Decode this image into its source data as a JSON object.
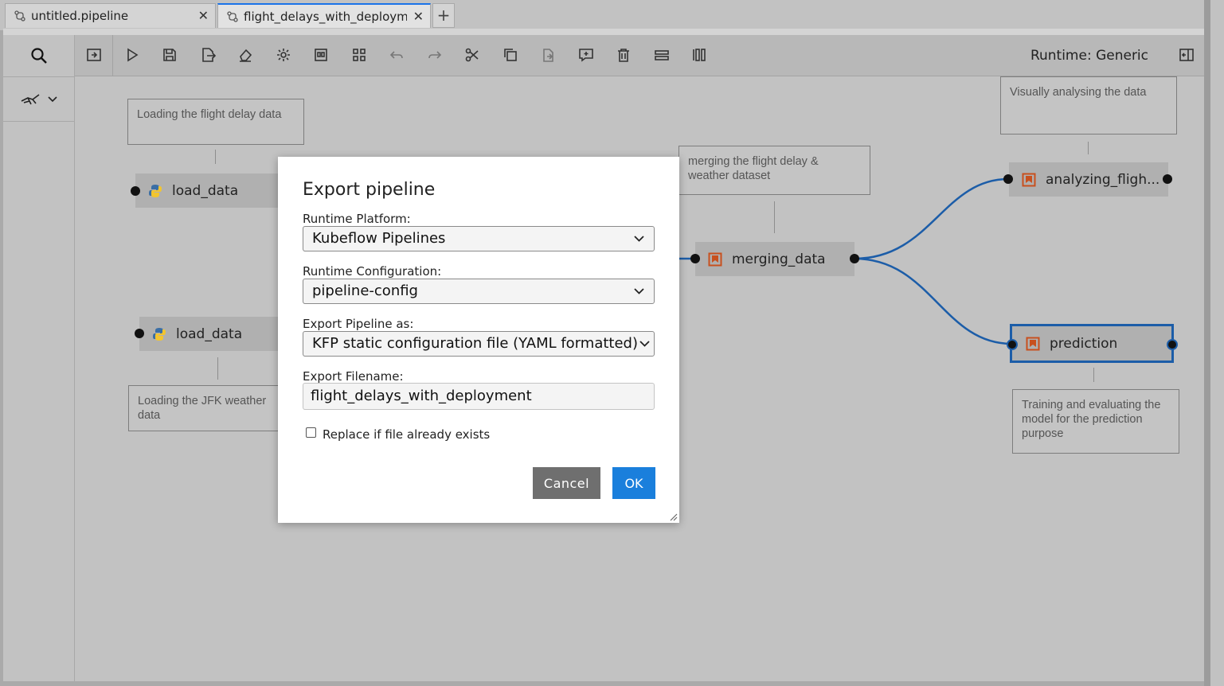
{
  "tabs": [
    {
      "label": "untitled.pipeline",
      "close": "✕"
    },
    {
      "label": "flight_delays_with_deploym",
      "close": "✕"
    }
  ],
  "tab_add": "+",
  "toolbar": {
    "runtime_label": "Runtime: Generic",
    "buttons": [
      "open-panel-icon",
      "run-icon",
      "save-icon",
      "export-icon",
      "clear-icon",
      "settings-icon",
      "open-runtimes-icon",
      "component-catalog-icon",
      "undo-icon",
      "redo-icon",
      "cut-icon",
      "copy-icon",
      "paste-icon",
      "add-comment-icon",
      "delete-icon",
      "arrange-horizontal-icon",
      "arrange-vertical-icon"
    ]
  },
  "canvas": {
    "comments": [
      "Loading the flight delay data",
      "Loading the  JFK weather data",
      "merging the  flight delay & weather dataset",
      "Visually analysing the data",
      "Training and evaluating the model for the prediction purpose"
    ],
    "nodes": [
      {
        "label": "load_data",
        "icon": "python-icon"
      },
      {
        "label": "load_data",
        "icon": "python-icon"
      },
      {
        "label": "merging_data",
        "icon": "notebook-icon"
      },
      {
        "label": "analyzing_fligh...",
        "icon": "notebook-icon"
      },
      {
        "label": "prediction",
        "icon": "notebook-icon"
      }
    ],
    "link_color": "#1c5da8",
    "node_icon_color": "#c8501e"
  },
  "dialog": {
    "title": "Export pipeline",
    "runtime_platform_label": "Runtime Platform:",
    "runtime_platform_value": "Kubeflow Pipelines",
    "runtime_config_label": "Runtime Configuration:",
    "runtime_config_value": "pipeline-config",
    "export_as_label": "Export Pipeline as:",
    "export_as_value": "KFP static configuration file (YAML formatted)",
    "filename_label": "Export Filename:",
    "filename_value": "flight_delays_with_deployment",
    "replace_label": "Replace if file already exists",
    "replace_checked": false,
    "cancel_label": "Cancel",
    "ok_label": "OK",
    "ok_color": "#1a7fdc"
  }
}
